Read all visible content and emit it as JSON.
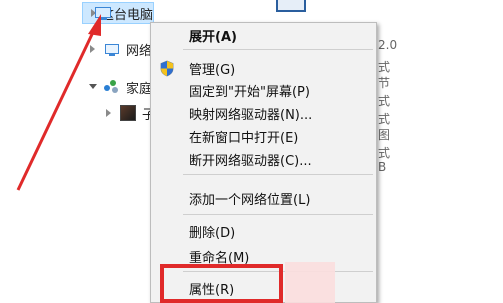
{
  "nav": {
    "this_pc": "这台电脑",
    "network": "网络",
    "homegroup": "家庭",
    "child": "子"
  },
  "right_fragments": [
    "2.0",
    "式",
    "节",
    "式",
    "式",
    "图",
    "式",
    "B"
  ],
  "context_menu": {
    "items": [
      "展开(A)",
      "管理(G)",
      "固定到\"开始\"屏幕(P)",
      "映射网络驱动器(N)...",
      "在新窗口中打开(E)",
      "断开网络驱动器(C)...",
      "添加一个网络位置(L)",
      "删除(D)",
      "重命名(M)",
      "属性(R)"
    ]
  },
  "annotation": {
    "color": "#e02a2a"
  }
}
